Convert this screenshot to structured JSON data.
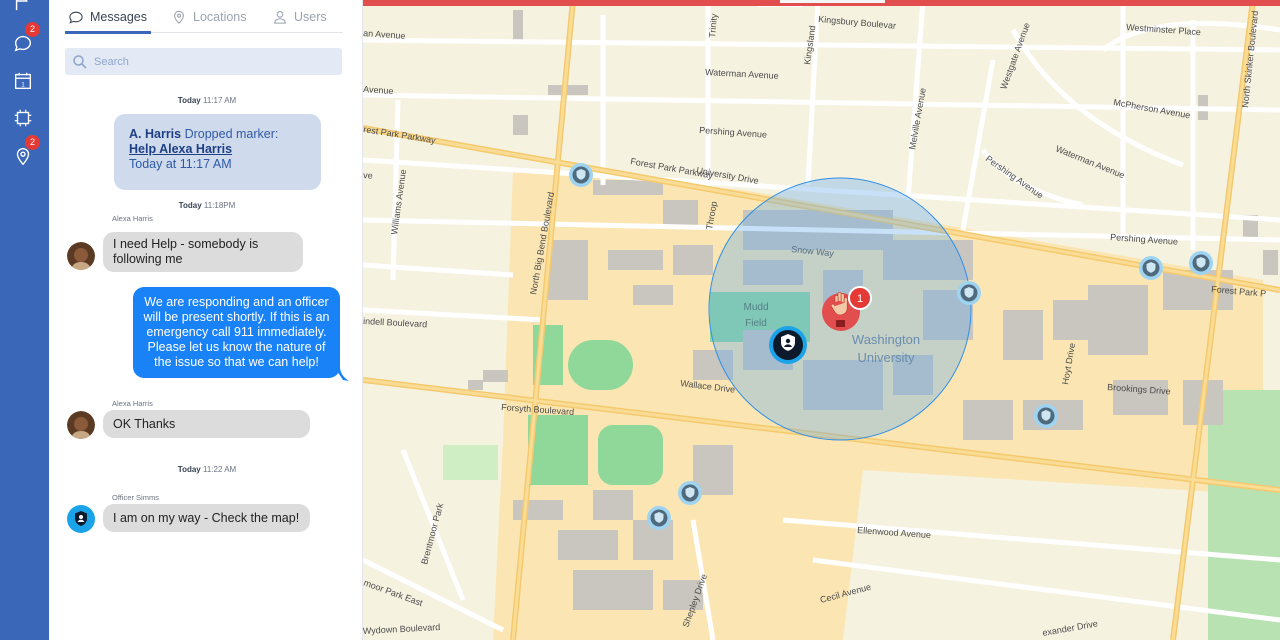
{
  "rail": {
    "items": [
      {
        "icon": "flag-icon",
        "badge": ""
      },
      {
        "icon": "chat-icon",
        "badge": "2"
      },
      {
        "icon": "calendar-icon",
        "badge": ""
      },
      {
        "icon": "chip-icon",
        "badge": ""
      },
      {
        "icon": "location-pin-icon",
        "badge": "2"
      }
    ],
    "calendar_day": "1",
    "color": "#3a67b8",
    "badge_color": "#e53935"
  },
  "tabs": [
    {
      "label": "Messages",
      "icon": "chat-bubble-icon",
      "active": true
    },
    {
      "label": "Locations",
      "icon": "location-pin-icon",
      "active": false
    },
    {
      "label": "Users",
      "icon": "user-icon",
      "active": false
    }
  ],
  "search": {
    "placeholder": "Search",
    "value": ""
  },
  "chat": {
    "ts1": {
      "day": "Today",
      "time": "11:17 AM"
    },
    "alert": {
      "who": "A. Harris",
      "action": "Dropped marker:",
      "link": "Help Alexa Harris",
      "time": "Today at 11:17 AM"
    },
    "ts2": {
      "day": "Today",
      "time": "11:18PM"
    },
    "msg1": {
      "sender": "Alexa Harris",
      "text": "I need Help - somebody is following me"
    },
    "msg2": {
      "text": "We are responding and an officer will be present shortly. If this is an emergency call 911 immediately. Please let us know the nature of the issue so that we can help!"
    },
    "msg3": {
      "sender": "Alexa Harris",
      "text": "OK Thanks"
    },
    "ts3": {
      "day": "Today",
      "time": "11:22 AM"
    },
    "msg4": {
      "sender": "Officer Simms",
      "text": "I am on my way - Check the map!"
    }
  },
  "map": {
    "streets": [
      "Kingsbury Boulevar",
      "Westminster Place",
      "Waterman Avenue",
      "McPherson Avenue",
      "Pershing Avenue",
      "Forest Park Parkway",
      "University Drive",
      "Waterman Avenue",
      "Pershing Avenue",
      "Westgate Avenue",
      "Melville Avenue",
      "Snow Way",
      "Pershing Avenue",
      "Forest Park P",
      "Brookings Drive",
      "Hoyt Drive",
      "Wallace Drive",
      "Forsyth Boulevard",
      "North Big Bend Boulevard",
      "Williams Avenue",
      "indell Boulevard",
      "Brentmoor Park",
      "Ellenwood Avenue",
      "Cecil Avenue",
      "Shepley Drive",
      "Wydown Boulevard",
      "exander Drive",
      "North Skinker Boulevard",
      "Throop",
      "Kingsland",
      "Trinity",
      "an Avenue",
      "Avenue",
      "rest Park Parkway",
      "ve",
      "moor Park East"
    ],
    "place": {
      "name1": "Washington",
      "name2": "University"
    },
    "field": {
      "name1": "Mudd",
      "name2": "Field"
    },
    "alert_marker": {
      "count": "1",
      "icon": "raised-hand-icon"
    },
    "officer_marker_icon": "shield-person-icon",
    "accent": "#e24d4d"
  }
}
